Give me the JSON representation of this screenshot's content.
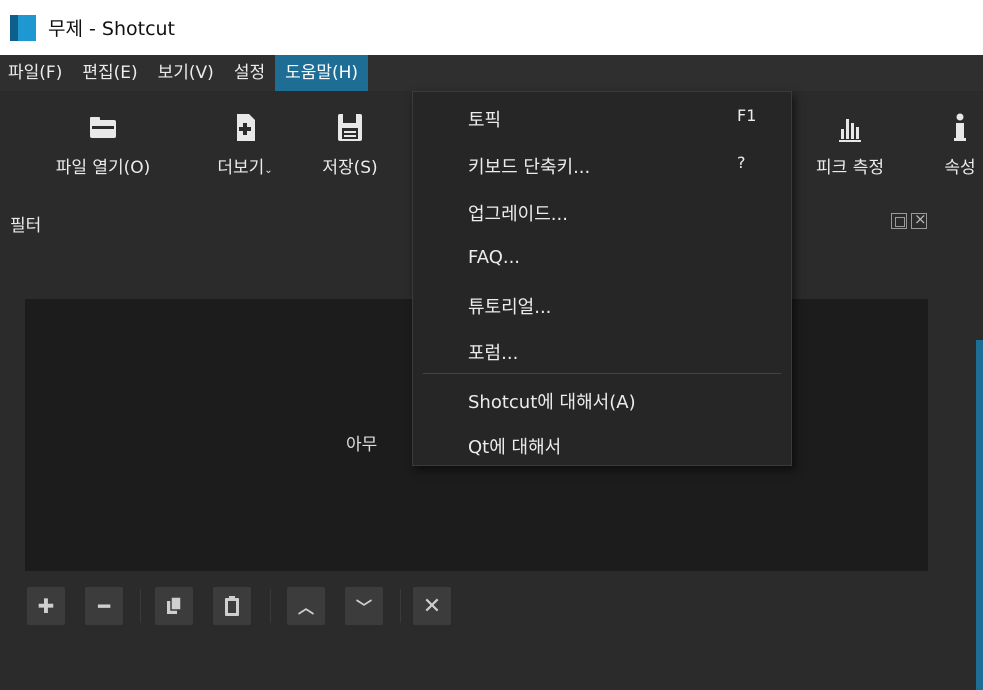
{
  "window": {
    "title": "무제 - Shotcut"
  },
  "menubar": {
    "items": [
      {
        "label": "파일(F)"
      },
      {
        "label": "편집(E)"
      },
      {
        "label": "보기(V)"
      },
      {
        "label": "설정"
      },
      {
        "label": "도움말(H)",
        "active": true
      }
    ]
  },
  "toolbar": {
    "items": [
      {
        "label": "파일 열기(O)",
        "icon": "folder-icon"
      },
      {
        "label": "더보기",
        "icon": "file-add-icon"
      },
      {
        "label": "저장(S)",
        "icon": "save-icon"
      },
      {
        "label": "피크 측정",
        "icon": "peak-meter-icon"
      },
      {
        "label": "속성",
        "icon": "info-icon"
      }
    ]
  },
  "filter_panel": {
    "title": "필터",
    "empty_text": "아무 ",
    "buttons": [
      "add-icon",
      "remove-icon",
      "copy-icon",
      "paste-icon",
      "move-up-icon",
      "move-down-icon",
      "close-icon"
    ]
  },
  "help_menu": {
    "items": [
      {
        "label": "토픽",
        "shortcut": "F1"
      },
      {
        "label": "키보드 단축키...",
        "shortcut": "?"
      },
      {
        "label": "업그레이드...",
        "shortcut": ""
      },
      {
        "label": "FAQ...",
        "shortcut": ""
      },
      {
        "label": "튜토리얼...",
        "shortcut": ""
      },
      {
        "label": "포럼...",
        "shortcut": ""
      },
      {
        "label": "Shotcut에 대해서(A)",
        "shortcut": ""
      },
      {
        "label": "Qt에 대해서",
        "shortcut": ""
      }
    ]
  },
  "colors": {
    "accent": "#1e6d95",
    "background": "#2b2b2b",
    "menu_bg": "#262626"
  }
}
